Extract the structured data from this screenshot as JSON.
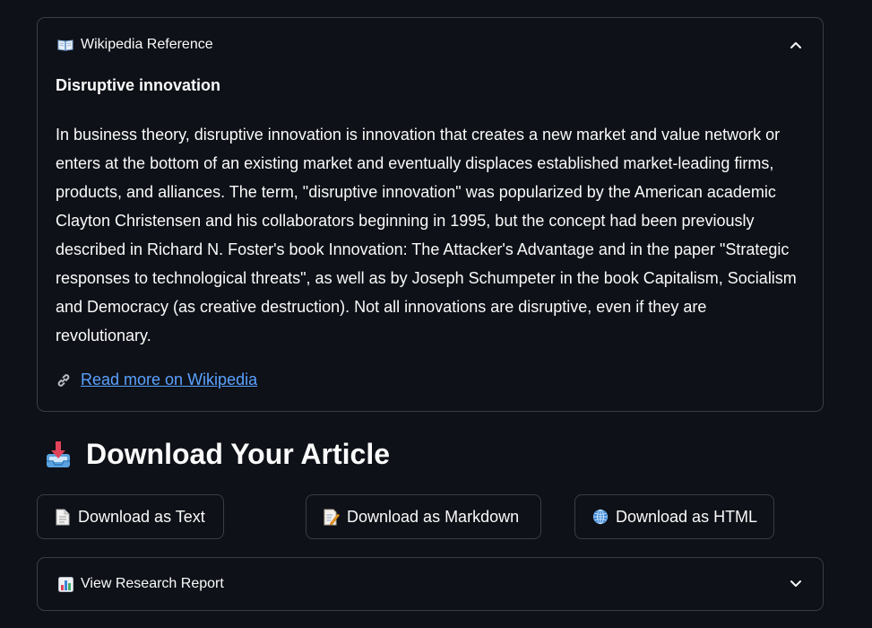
{
  "wiki_expander": {
    "title": "Wikipedia Reference",
    "icon": "open-book-icon",
    "expanded": true,
    "heading": "Disruptive innovation",
    "paragraph": "In business theory, disruptive innovation is innovation that creates a new market and value network or enters at the bottom of an existing market and eventually displaces established market-leading firms, products, and alliances. The term, \"disruptive innovation\" was popularized by the American academic Clayton Christensen and his collaborators beginning in 1995, but the concept had been previously described in Richard N. Foster's book Innovation: The Attacker's Advantage and in the paper \"Strategic responses to technological threats\", as well as by Joseph Schumpeter in the book Capitalism, Socialism and Democracy (as creative destruction). Not all innovations are disruptive, even if they are revolutionary.",
    "link_icon": "link-icon",
    "link_label": "Read more on Wikipedia"
  },
  "download_section": {
    "icon": "inbox-tray-icon",
    "title": "Download Your Article",
    "buttons": [
      {
        "icon": "page-icon",
        "label": "Download as Text"
      },
      {
        "icon": "memo-icon",
        "label": "Download as Markdown"
      },
      {
        "icon": "globe-icon",
        "label": "Download as HTML"
      }
    ]
  },
  "report_expander": {
    "title": "View Research Report",
    "icon": "bar-chart-icon",
    "expanded": false
  },
  "colors": {
    "background": "#0e1117",
    "border": "#3a3d46",
    "text": "#fafafa",
    "link": "#5aa1ff"
  }
}
